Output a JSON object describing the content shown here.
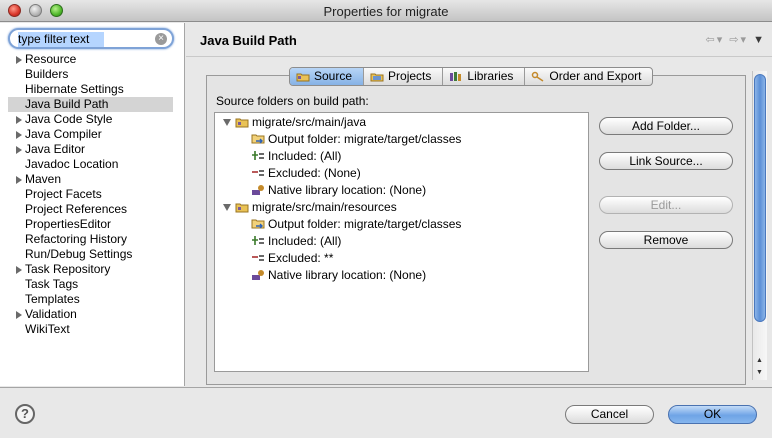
{
  "window": {
    "title": "Properties for migrate"
  },
  "filter": {
    "value": "type filter text"
  },
  "nav": [
    {
      "label": "Resource",
      "expandable": true
    },
    {
      "label": "Builders",
      "expandable": false
    },
    {
      "label": "Hibernate Settings",
      "expandable": false
    },
    {
      "label": "Java Build Path",
      "expandable": false,
      "selected": true
    },
    {
      "label": "Java Code Style",
      "expandable": true
    },
    {
      "label": "Java Compiler",
      "expandable": true
    },
    {
      "label": "Java Editor",
      "expandable": true
    },
    {
      "label": "Javadoc Location",
      "expandable": false
    },
    {
      "label": "Maven",
      "expandable": true
    },
    {
      "label": "Project Facets",
      "expandable": false
    },
    {
      "label": "Project References",
      "expandable": false
    },
    {
      "label": "PropertiesEditor",
      "expandable": false
    },
    {
      "label": "Refactoring History",
      "expandable": false
    },
    {
      "label": "Run/Debug Settings",
      "expandable": false
    },
    {
      "label": "Task Repository",
      "expandable": true
    },
    {
      "label": "Task Tags",
      "expandable": false
    },
    {
      "label": "Templates",
      "expandable": false
    },
    {
      "label": "Validation",
      "expandable": true
    },
    {
      "label": "WikiText",
      "expandable": false
    }
  ],
  "page": {
    "title": "Java Build Path"
  },
  "tabs": {
    "source": "Source",
    "projects": "Projects",
    "libraries": "Libraries",
    "order": "Order and Export",
    "active": "Source"
  },
  "source": {
    "label": "Source folders on build path:",
    "folders": [
      {
        "path": "migrate/src/main/java",
        "output": "Output folder: migrate/target/classes",
        "included": "Included: (All)",
        "excluded": "Excluded: (None)",
        "native": "Native library location: (None)"
      },
      {
        "path": "migrate/src/main/resources",
        "output": "Output folder: migrate/target/classes",
        "included": "Included: (All)",
        "excluded": "Excluded: **",
        "native": "Native library location: (None)"
      }
    ]
  },
  "buttons": {
    "add_folder": "Add Folder...",
    "link_source": "Link Source...",
    "edit": "Edit...",
    "remove": "Remove"
  },
  "footer": {
    "cancel": "Cancel",
    "ok": "OK"
  },
  "icons": {
    "help": "help-icon",
    "folder": "source-folder-icon",
    "back": "back-arrow-icon",
    "forward": "forward-arrow-icon"
  },
  "colors": {
    "selection": "#b5d5ff",
    "ok_button": "#6fa4e6",
    "scroll_thumb": "#5b8fd6"
  }
}
